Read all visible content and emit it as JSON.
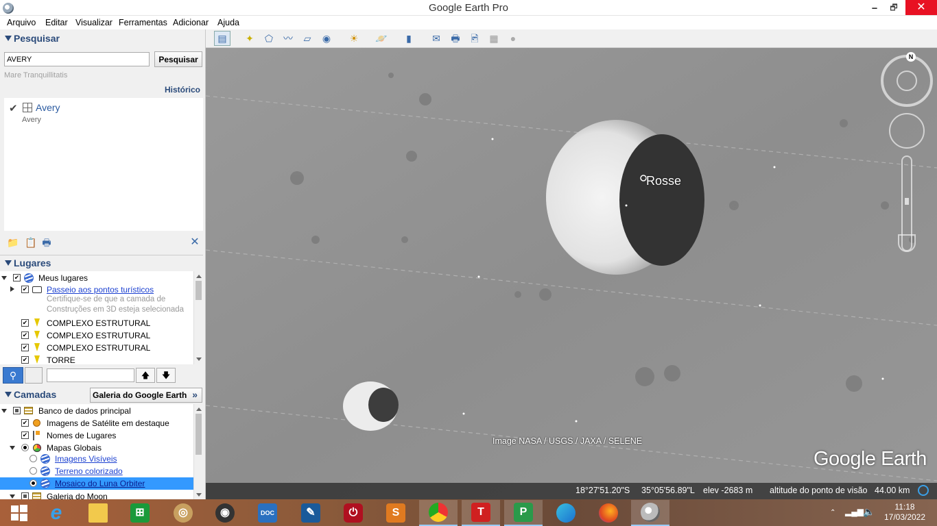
{
  "window": {
    "title": "Google Earth Pro",
    "minimize": "🗕",
    "maximize": "🗗",
    "close": "✕"
  },
  "menu": [
    "Arquivo",
    "Editar",
    "Visualizar",
    "Ferramentas",
    "Adicionar",
    "Ajuda"
  ],
  "search": {
    "header": "Pesquisar",
    "input_value": "AVERY",
    "button": "Pesquisar",
    "hint": "Mare Tranquillitatis",
    "history": "Histórico",
    "result_title": "Avery",
    "result_subtitle": "Avery"
  },
  "places": {
    "header": "Lugares",
    "items": [
      {
        "label": "Meus lugares"
      },
      {
        "label": "Passeio aos pontos turísticos"
      },
      {
        "label": "Certifique-se de que a camada de"
      },
      {
        "label": "Construções em 3D esteja selecionada"
      },
      {
        "label": "COMPLEXO ESTRUTURAL"
      },
      {
        "label": "COMPLEXO ESTRUTURAL"
      },
      {
        "label": "COMPLEXO ESTRUTURAL"
      },
      {
        "label": "TORRE"
      }
    ]
  },
  "layers": {
    "header": "Camadas",
    "gallery_button": "Galeria do Google Earth",
    "items": [
      {
        "label": "Banco de dados principal"
      },
      {
        "label": "Imagens de Satélite em destaque"
      },
      {
        "label": "Nomes de Lugares"
      },
      {
        "label": "Mapas Globais"
      },
      {
        "label": "Imagens Visíveis"
      },
      {
        "label": "Terreno colorizado"
      },
      {
        "label": "Mosaico do Luna Orbiter"
      },
      {
        "label": "Galeria do Moon"
      }
    ]
  },
  "map": {
    "crater_label": "Rosse",
    "attribution": "Image NASA / USGS / JAXA / SELENE",
    "logo": "Google Earth",
    "compass_north": "N"
  },
  "status": {
    "lat": "18°27'51.20\"S",
    "lon": "35°05'56.89\"L",
    "elev": "elev -2683 m",
    "eye_alt_label": "altitude do ponto de visão",
    "eye_alt_value": "44.00 km"
  },
  "clock": {
    "time": "11:18",
    "date": "17/03/2022"
  },
  "colors": {
    "accent": "#2a4a7a",
    "link": "#1a3fd0",
    "selected_row": "#3399ff",
    "close_button": "#e81123"
  }
}
